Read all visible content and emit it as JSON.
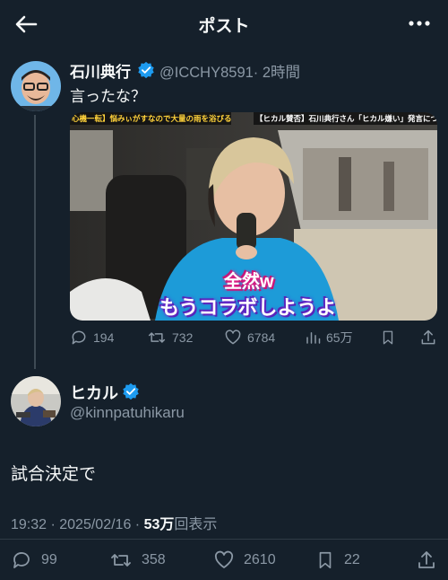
{
  "header": {
    "title": "ポスト",
    "back_icon": "arrow-left-icon",
    "more_icon": "more-dots-icon"
  },
  "parent_tweet": {
    "name": "石川典行",
    "handle": "@ICCHY8591",
    "time": "· 2時間",
    "text": "言ったな？",
    "media": {
      "top_caption_left": "心機一転】悩みぃがすなので大量の雨を浴びるぞ!!",
      "top_caption_right": "【ヒカル賛否】石川典行さん「ヒカル嫌い」発言について",
      "subtitle_line1": "全然w",
      "subtitle_line2": "もうコラボしようよ"
    },
    "stats": {
      "replies": "194",
      "retweets": "732",
      "likes": "6784",
      "views": "65万"
    }
  },
  "reply_tweet": {
    "name": "ヒカル",
    "handle": "@kinnpatuhikaru",
    "text": "試合決定で",
    "time": "19:32 · 2025/02/16 · ",
    "views_count": "53万",
    "views_label": "回表示",
    "stats": {
      "replies": "99",
      "retweets": "358",
      "likes": "2610",
      "bookmarks": "22"
    }
  },
  "colors": {
    "background": "#15202b",
    "muted": "#8b98a5",
    "verified": "#1d9bf0"
  }
}
